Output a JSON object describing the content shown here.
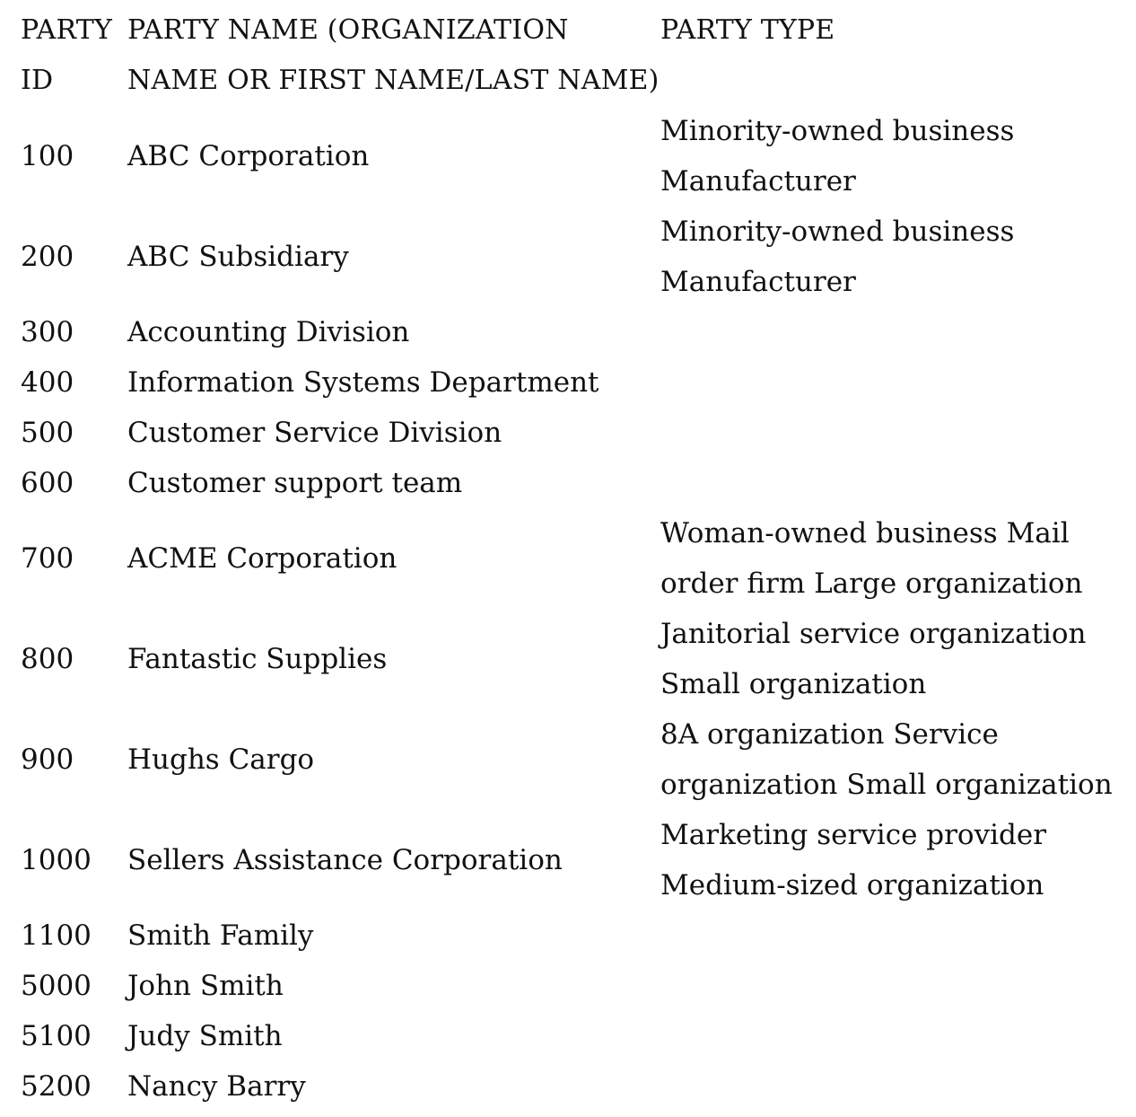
{
  "table": {
    "headers": {
      "party_id": "PARTY ID",
      "party_name": "PARTY NAME (ORGANIZATION NAME OR FIRST NAME/LAST NAME)",
      "party_type": "PARTY TYPE"
    },
    "rows": [
      {
        "id": "100",
        "name": "ABC Corporation",
        "type": "Minority-owned business Manufacturer"
      },
      {
        "id": "200",
        "name": "ABC Subsidiary",
        "type": "Minority-owned business Manufacturer"
      },
      {
        "id": "300",
        "name": "Accounting Division",
        "type": ""
      },
      {
        "id": "400",
        "name": "Information Systems Department",
        "type": ""
      },
      {
        "id": "500",
        "name": "Customer Service Division",
        "type": ""
      },
      {
        "id": "600",
        "name": "Customer support team",
        "type": ""
      },
      {
        "id": "700",
        "name": "ACME Corporation",
        "type": "Woman-owned business Mail order firm Large organization"
      },
      {
        "id": "800",
        "name": "Fantastic Supplies",
        "type": "Janitorial service organization Small organization"
      },
      {
        "id": "900",
        "name": "Hughs Cargo",
        "type": "8A organization Service organization Small organization"
      },
      {
        "id": "1000",
        "name": "Sellers Assistance Corporation",
        "type": "Marketing service provider Medium-sized organization"
      },
      {
        "id": "1100",
        "name": "Smith Family",
        "type": ""
      },
      {
        "id": "5000",
        "name": "John Smith",
        "type": ""
      },
      {
        "id": "5100",
        "name": "Judy Smith",
        "type": ""
      },
      {
        "id": "5200",
        "name": "Nancy Barry",
        "type": ""
      }
    ]
  }
}
